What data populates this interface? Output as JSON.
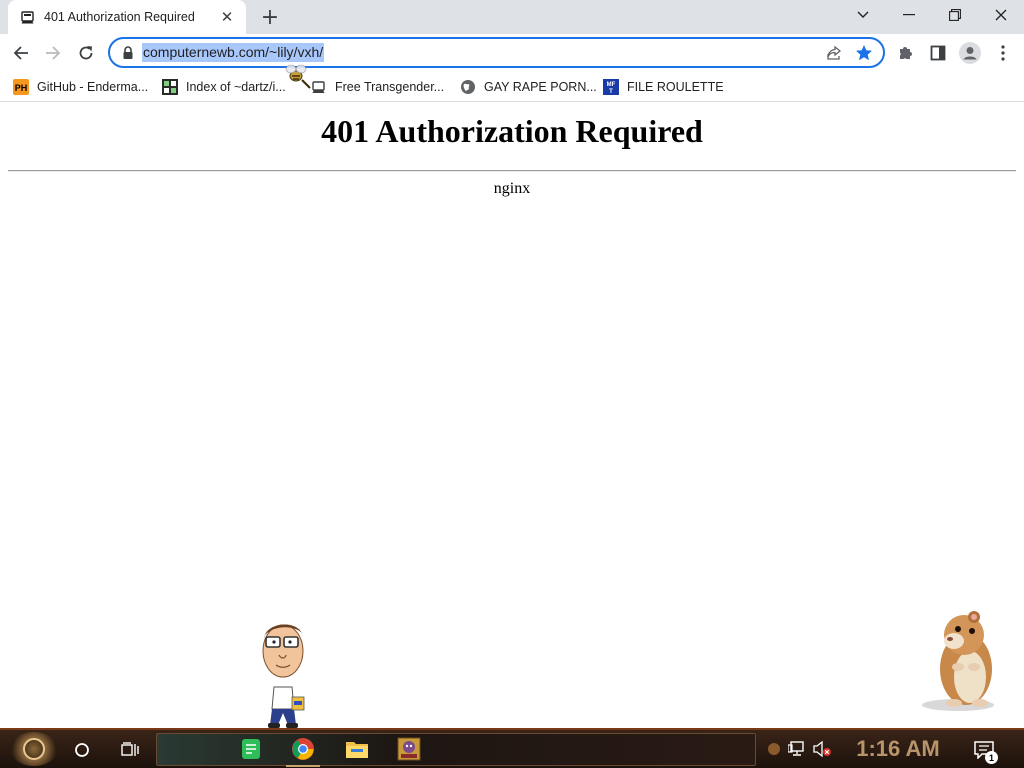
{
  "browser": {
    "tab": {
      "title": "401 Authorization Required",
      "favicon": "generic-page-icon",
      "close_glyph": "✕"
    },
    "new_tab_glyph": "+",
    "window_controls": [
      "chevron-down-icon",
      "minimize-icon",
      "restore-icon",
      "close-icon"
    ],
    "toolbar": {
      "url": "computernewb.com/~lily/vxh/",
      "url_selected": true,
      "bookmarked": true,
      "accent_color": "#1a73e8",
      "selection_color": "#a8c7fa"
    },
    "bookmarks": [
      {
        "label": "GitHub - Enderma...",
        "icon": "ph-icon",
        "icon_text": "PH",
        "icon_color": "#f7971d"
      },
      {
        "label": "Index of ~dartz/i...",
        "icon": "index-icon",
        "icon_text": "",
        "icon_color": "#2a2a2a"
      },
      {
        "label": "Free Transgender...",
        "icon": "generic-page-icon",
        "icon_text": "",
        "icon_color": "#5f6368"
      },
      {
        "label": "GAY RAPE PORN...",
        "icon": "globe-icon",
        "icon_text": "",
        "icon_color": "#5f6368"
      },
      {
        "label": "FILE ROULETTE",
        "icon": "mft-icon",
        "icon_text": "MFT",
        "icon_color": "#1a3aa8"
      }
    ]
  },
  "page": {
    "heading": "401 Authorization Required",
    "server": "nginx"
  },
  "taskbar": {
    "clock": "1:16 AM",
    "notification_count": "1",
    "theme_color": "#3a2418",
    "pinned_apps": [
      "notes-icon",
      "chrome-icon",
      "file-explorer-icon",
      "bonzi-icon"
    ]
  }
}
